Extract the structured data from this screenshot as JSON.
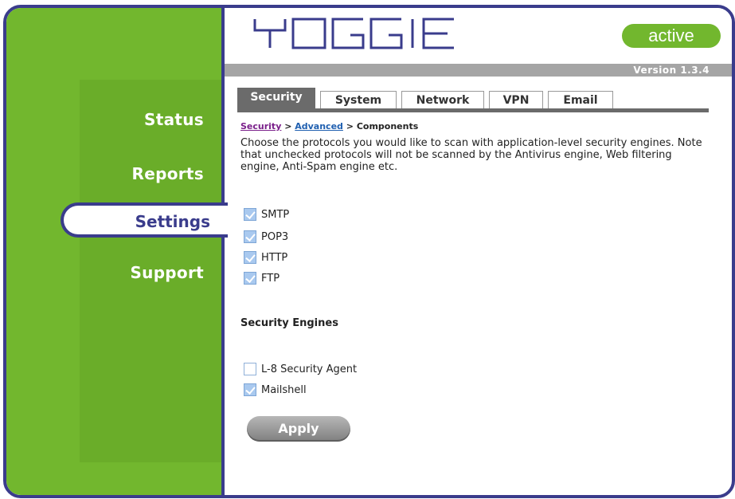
{
  "brand": {
    "logo_text": "YOGGIE",
    "status": "active",
    "version": "Version 1.3.4"
  },
  "sidebar": {
    "items": [
      {
        "label": "Status"
      },
      {
        "label": "Reports"
      },
      {
        "label": "Settings"
      },
      {
        "label": "Support"
      }
    ]
  },
  "tabs": [
    {
      "label": "Security",
      "active": true
    },
    {
      "label": "System"
    },
    {
      "label": "Network"
    },
    {
      "label": "VPN"
    },
    {
      "label": "Email"
    }
  ],
  "breadcrumb": {
    "security": "Security",
    "sep1": " > ",
    "advanced": "Advanced",
    "sep2": " > ",
    "current": "Components"
  },
  "description": "Choose the protocols you would like to scan with application-level security engines. Note that unchecked protocols will not be scanned by the Antivirus engine, Web filtering engine, Anti-Spam engine etc.",
  "protocols": [
    {
      "label": "SMTP",
      "checked": true
    },
    {
      "label": "POP3",
      "checked": true
    },
    {
      "label": "HTTP",
      "checked": true
    },
    {
      "label": "FTP",
      "checked": true
    }
  ],
  "engines_title": "Security Engines",
  "engines": [
    {
      "label": "L-8 Security Agent",
      "checked": false
    },
    {
      "label": "Mailshell",
      "checked": true
    }
  ],
  "apply_label": "Apply",
  "colors": {
    "green": "#72b72e",
    "navy": "#3a3c8c",
    "tab_gray": "#6b6b6b"
  }
}
